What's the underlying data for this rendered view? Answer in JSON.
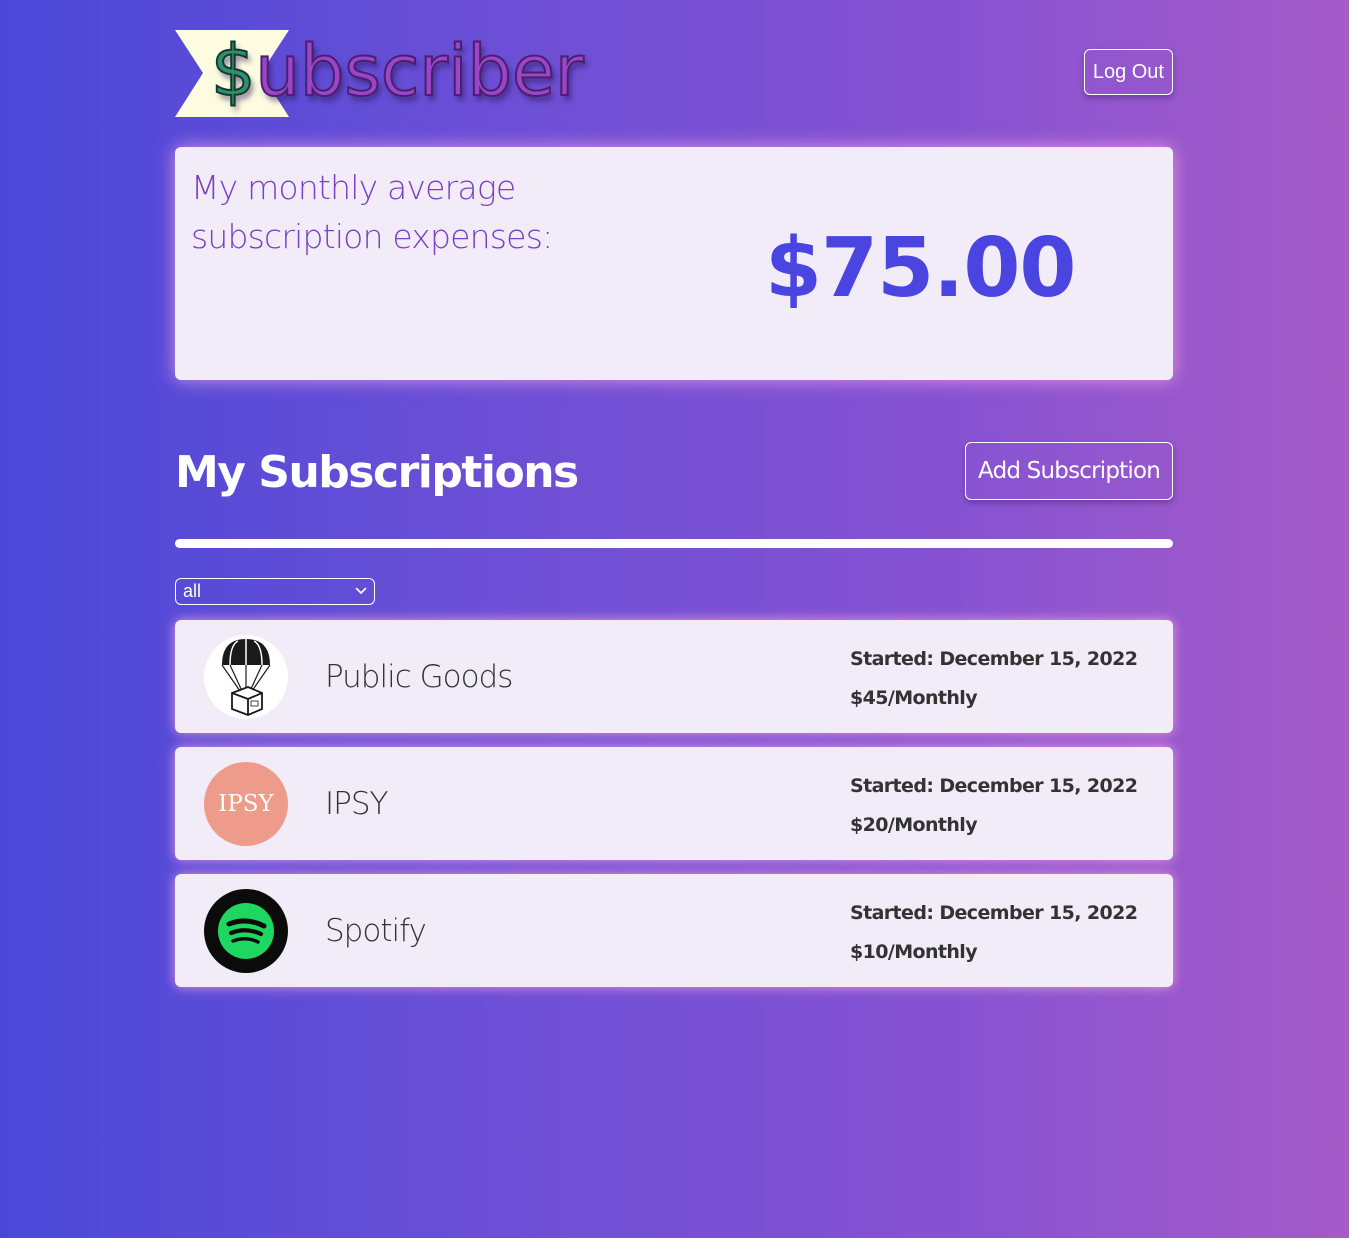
{
  "header": {
    "logo_dollar": "$",
    "logo_rest": "ubscriber",
    "logout_label": "Log Out"
  },
  "average": {
    "label": "My monthly average subscription expenses:",
    "amount": "$75.00"
  },
  "subscriptions_section": {
    "title": "My Subscriptions",
    "add_label": "Add Subscription",
    "filter_value": "all"
  },
  "subscriptions": [
    {
      "name": "Public Goods",
      "started": "Started: December 15, 2022",
      "price": "$45/Monthly",
      "logo_icon": "parachute-box-icon"
    },
    {
      "name": "IPSY",
      "logo_text": "IPSY",
      "started": "Started: December 15, 2022",
      "price": "$20/Monthly",
      "logo_icon": "ipsy-logo-icon"
    },
    {
      "name": "Spotify",
      "started": "Started: December 15, 2022",
      "price": "$10/Monthly",
      "logo_icon": "spotify-icon"
    }
  ],
  "colors": {
    "accent": "#4a45e0",
    "label_purple": "#7c3fc4",
    "card_bg": "#f1ecf8",
    "ipsy_pink": "#ee9b8c",
    "spotify_green": "#1ed760"
  }
}
